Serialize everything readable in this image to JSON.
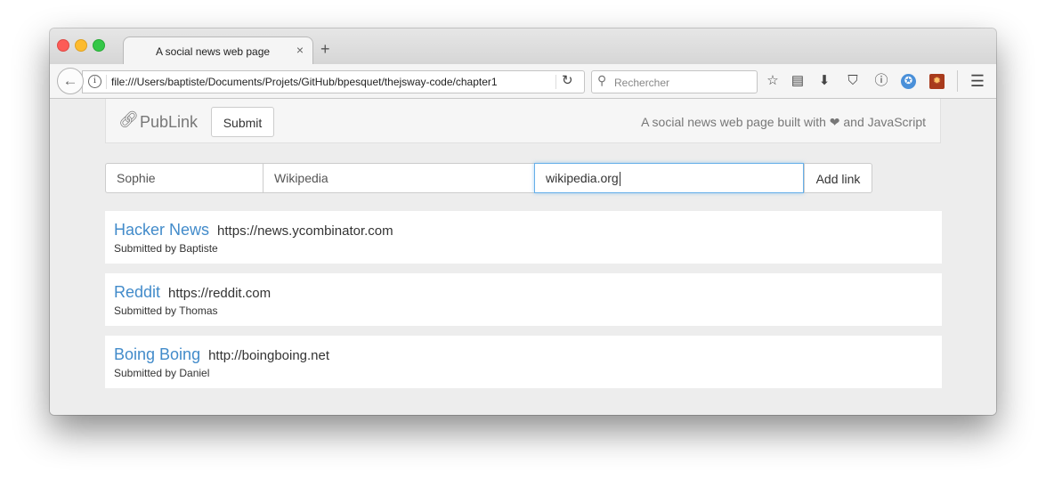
{
  "browser": {
    "tab_title": "A social news web page",
    "tab_close": "×",
    "new_tab": "+",
    "url": "file:///Users/baptiste/Documents/Projets/GitHub/bpesquet/thejsway-code/chapter1",
    "search_placeholder": "Rechercher"
  },
  "app": {
    "brand": "PubLink",
    "submit_label": "Submit",
    "tagline": "A social news web page built with ❤ and JavaScript"
  },
  "form": {
    "author_value": "Sophie",
    "title_value": "Wikipedia",
    "url_value": "wikipedia.org",
    "add_link_label": "Add link"
  },
  "links": [
    {
      "title": "Hacker News",
      "url": "https://news.ycombinator.com",
      "author": "Submitted by Baptiste"
    },
    {
      "title": "Reddit",
      "url": "https://reddit.com",
      "author": "Submitted by Thomas"
    },
    {
      "title": "Boing Boing",
      "url": "http://boingboing.net",
      "author": "Submitted by Daniel"
    }
  ]
}
